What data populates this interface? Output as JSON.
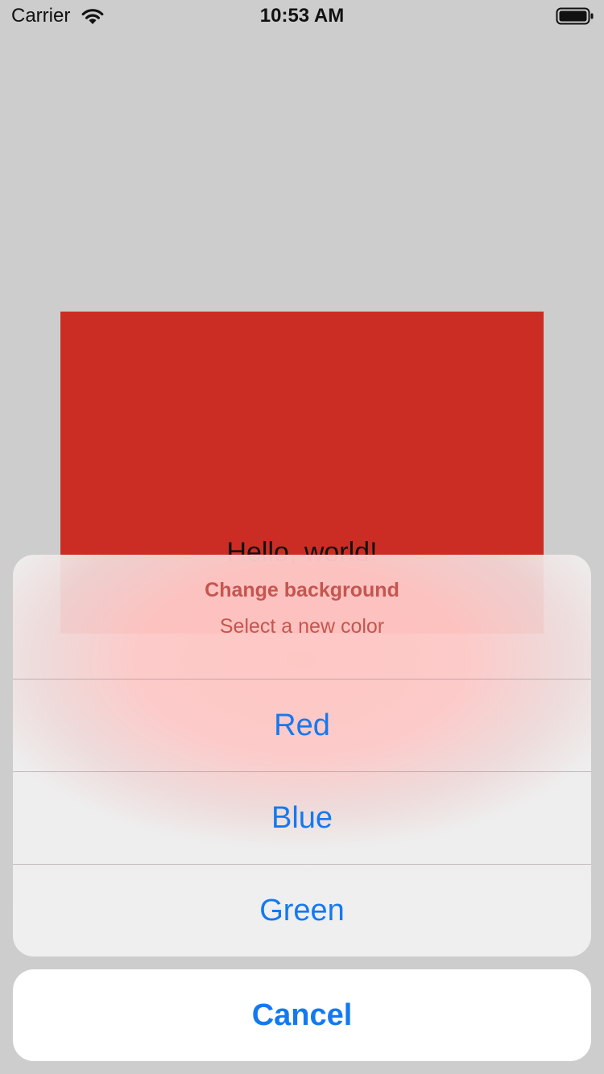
{
  "status_bar": {
    "carrier": "Carrier",
    "time": "10:53 AM",
    "icons": [
      "wifi-icon",
      "battery-icon"
    ]
  },
  "content": {
    "panel_color": "#cb2d24",
    "label": "Hello, world!"
  },
  "action_sheet": {
    "title": "Change background",
    "message": "Select a new color",
    "options": [
      {
        "label": "Red"
      },
      {
        "label": "Blue"
      },
      {
        "label": "Green"
      }
    ],
    "cancel_label": "Cancel",
    "accent_color": "#1479f0",
    "header_text_color": "#c6554f"
  }
}
